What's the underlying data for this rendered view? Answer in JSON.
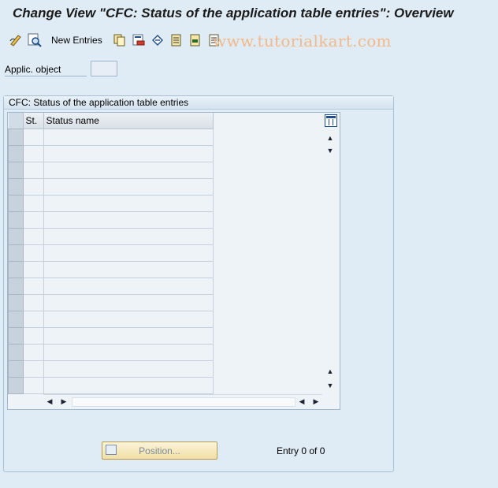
{
  "window": {
    "title": "Change View \"CFC: Status of the application table entries\": Overview"
  },
  "toolbar": {
    "new_entries_label": "New Entries",
    "icons": [
      "change-display-icon",
      "find-icon",
      "copy-as-icon",
      "delete-icon",
      "undo-change-icon",
      "select-all-icon",
      "select-block-icon",
      "deselect-all-icon"
    ]
  },
  "watermark": "www.tutorialkart.com",
  "selection": {
    "field_label": "Applic. object",
    "field_value": ""
  },
  "group": {
    "title": "CFC: Status of the application table entries"
  },
  "table": {
    "columns": [
      "St.",
      "Status name"
    ],
    "rows": [
      [
        "",
        ""
      ],
      [
        "",
        ""
      ],
      [
        "",
        ""
      ],
      [
        "",
        ""
      ],
      [
        "",
        ""
      ],
      [
        "",
        ""
      ],
      [
        "",
        ""
      ],
      [
        "",
        ""
      ],
      [
        "",
        ""
      ],
      [
        "",
        ""
      ],
      [
        "",
        ""
      ],
      [
        "",
        ""
      ],
      [
        "",
        ""
      ],
      [
        "",
        ""
      ],
      [
        "",
        ""
      ],
      [
        "",
        ""
      ]
    ]
  },
  "footer": {
    "position_button_label": "Position...",
    "entry_text": "Entry 0 of 0"
  }
}
